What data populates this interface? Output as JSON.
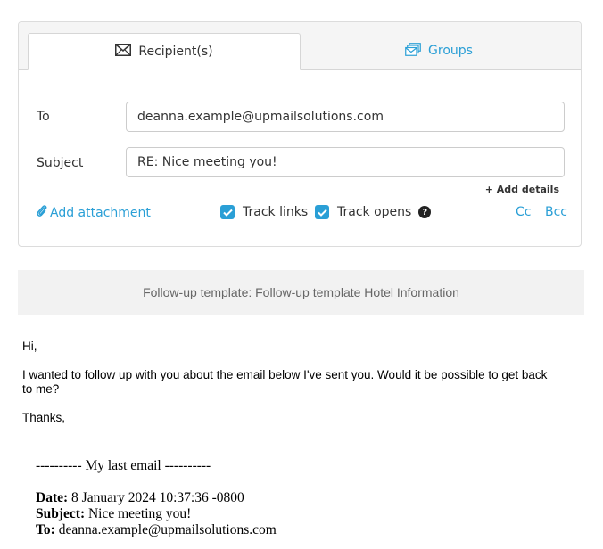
{
  "tabs": {
    "recipients_label": "Recipient(s)",
    "groups_label": "Groups"
  },
  "form": {
    "to_label": "To",
    "to_value": "deanna.example@upmailsolutions.com",
    "subject_label": "Subject",
    "subject_value": "RE: Nice meeting you!",
    "add_details_label": "+ Add details",
    "add_attachment_label": "Add attachment",
    "track_links_label": "Track links",
    "track_links_checked": true,
    "track_opens_label": "Track opens",
    "track_opens_checked": true,
    "help_glyph": "?",
    "cc_label": "Cc",
    "bcc_label": "Bcc"
  },
  "template_bar": {
    "text": "Follow-up template: Follow-up template Hotel Information"
  },
  "message": {
    "greeting": "Hi,",
    "paragraph": "I wanted to follow up with you about the email below I've sent you. Would it be possible to get back to me?",
    "signoff": "Thanks,",
    "separator": "---------- My last email ----------",
    "date_label": "Date:",
    "date_value": " 8 January 2024 10:37:36 -0800",
    "subject_label": "Subject:",
    "subject_value": " Nice meeting you!",
    "to_label": "To:",
    "to_value": " deanna.example@upmailsolutions.com"
  },
  "colors": {
    "accent": "#2a9fd6",
    "template_bar_bg": "#f2f2f2",
    "tabbar_bg": "#f5f5f5"
  },
  "icons": {
    "recipients_tab": "envelope-icon",
    "groups_tab": "stacked-envelopes-icon",
    "attachment": "paperclip-icon",
    "help": "question-circle-icon",
    "checkbox": "checkmark-icon"
  }
}
